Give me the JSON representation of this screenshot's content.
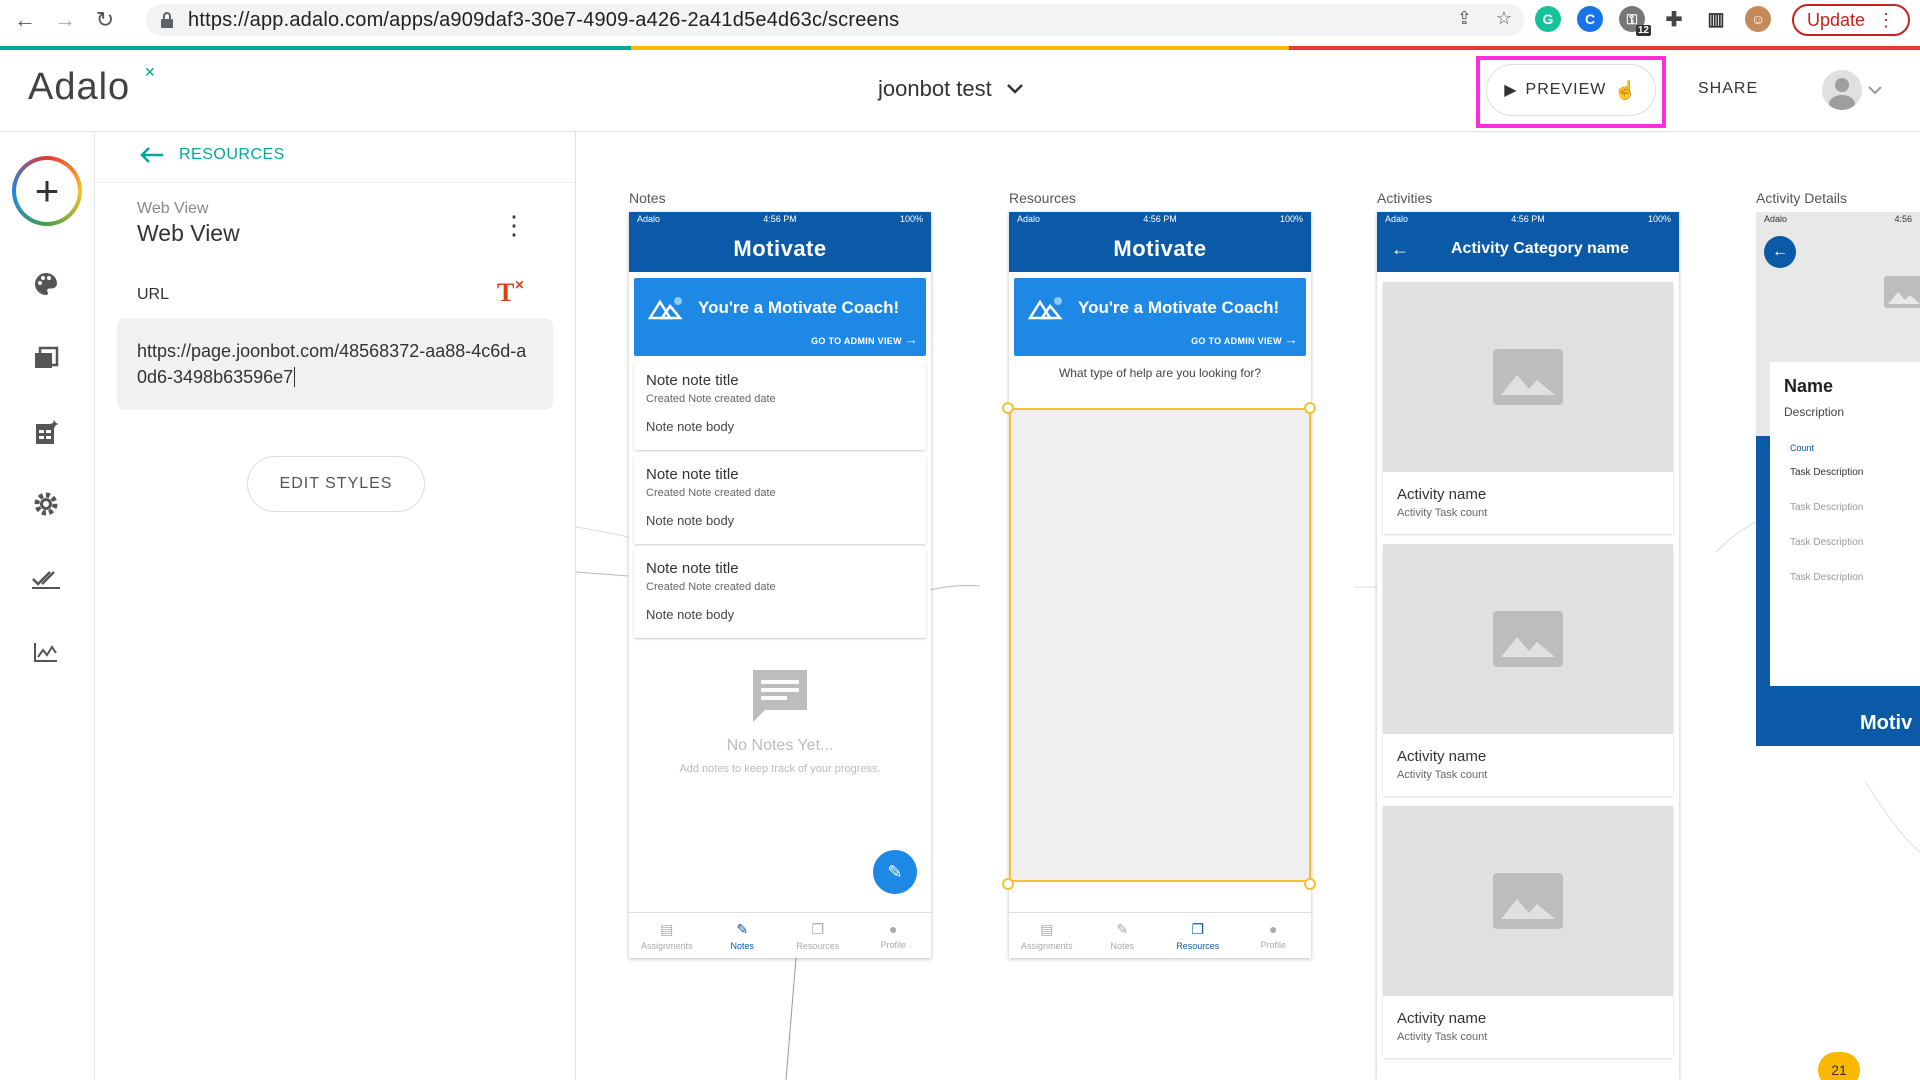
{
  "browser": {
    "url": "https://app.adalo.com/apps/a909daf3-30e7-4909-a426-2a41d5e4d63c/screens",
    "update_label": "Update",
    "ext_badge": "12"
  },
  "header": {
    "logo": "Adalo",
    "project_title": "joonbot test",
    "preview_label": "PREVIEW",
    "share_label": "SHARE"
  },
  "panel": {
    "back_label": "RESOURCES",
    "component_type": "Web View",
    "component_name": "Web View",
    "url_label": "URL",
    "url_value": "https://page.joonbot.com/48568372-aa88-4c6d-a0d6-3498b63596e7",
    "edit_styles_label": "EDIT STYLES"
  },
  "screens": {
    "notes": {
      "label": "Notes",
      "status_left": "Adalo",
      "status_time": "4:56 PM",
      "status_right": "100%",
      "app_title": "Motivate",
      "coach_title": "You're a Motivate Coach!",
      "coach_link": "GO TO ADMIN VIEW",
      "notes": [
        {
          "title": "Note note title",
          "date": "Created Note created date",
          "body": "Note note body"
        },
        {
          "title": "Note note title",
          "date": "Created Note created date",
          "body": "Note note body"
        },
        {
          "title": "Note note title",
          "date": "Created Note created date",
          "body": "Note note body"
        }
      ],
      "empty_title": "No Notes Yet...",
      "empty_sub": "Add notes to keep track of your progress.",
      "nav": [
        "Assignments",
        "Notes",
        "Resources",
        "Profile"
      ]
    },
    "resources": {
      "label": "Resources",
      "status_left": "Adalo",
      "status_time": "4:56 PM",
      "status_right": "100%",
      "app_title": "Motivate",
      "coach_title": "You're a Motivate Coach!",
      "coach_link": "GO TO ADMIN VIEW",
      "help_text": "What type of help are you looking for?",
      "nav": [
        "Assignments",
        "Notes",
        "Resources",
        "Profile"
      ]
    },
    "activities": {
      "label": "Activities",
      "status_left": "Adalo",
      "status_time": "4:56 PM",
      "status_right": "100%",
      "header_title": "Activity Category name",
      "cards": [
        {
          "name": "Activity name",
          "count": "Activity Task count"
        },
        {
          "name": "Activity name",
          "count": "Activity Task count"
        },
        {
          "name": "Activity name",
          "count": "Activity Task count"
        }
      ]
    },
    "activity_details": {
      "label": "Activity Details",
      "status_left": "Adalo",
      "status_time": "4:56",
      "name": "Name",
      "description": "Description",
      "count_label": "Count",
      "tasks": [
        "Task Description",
        "Task Description",
        "Task Description",
        "Task Description"
      ],
      "footer_logo": "Motiv"
    }
  },
  "notification_count": "21",
  "colors": {
    "accent": "#00a89d",
    "brand_blue": "#0b5aa8",
    "card_blue": "#1e88e5",
    "highlight": "#ff2de0",
    "selection": "#f2c233"
  }
}
